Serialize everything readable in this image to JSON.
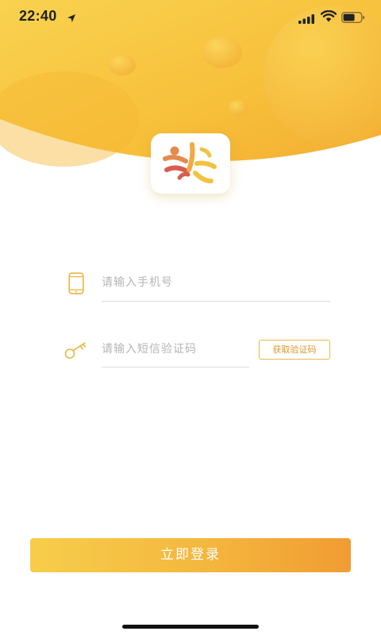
{
  "status_bar": {
    "time": "22:40"
  },
  "phone_field": {
    "placeholder": "请输入手机号",
    "value": ""
  },
  "code_field": {
    "placeholder": "请输入短信验证码",
    "value": ""
  },
  "get_code_button": {
    "label": "获取验证码"
  },
  "login_button": {
    "label": "立即登录"
  },
  "colors": {
    "accent": "#f7c23c",
    "accent_dark": "#f19c33",
    "icon": "#e9b640",
    "placeholder": "#b5b5b5"
  },
  "icons": [
    "location-arrow-icon",
    "signal-icon",
    "wifi-icon",
    "battery-icon",
    "app-logo",
    "phone-icon",
    "key-icon",
    "home-indicator"
  ]
}
